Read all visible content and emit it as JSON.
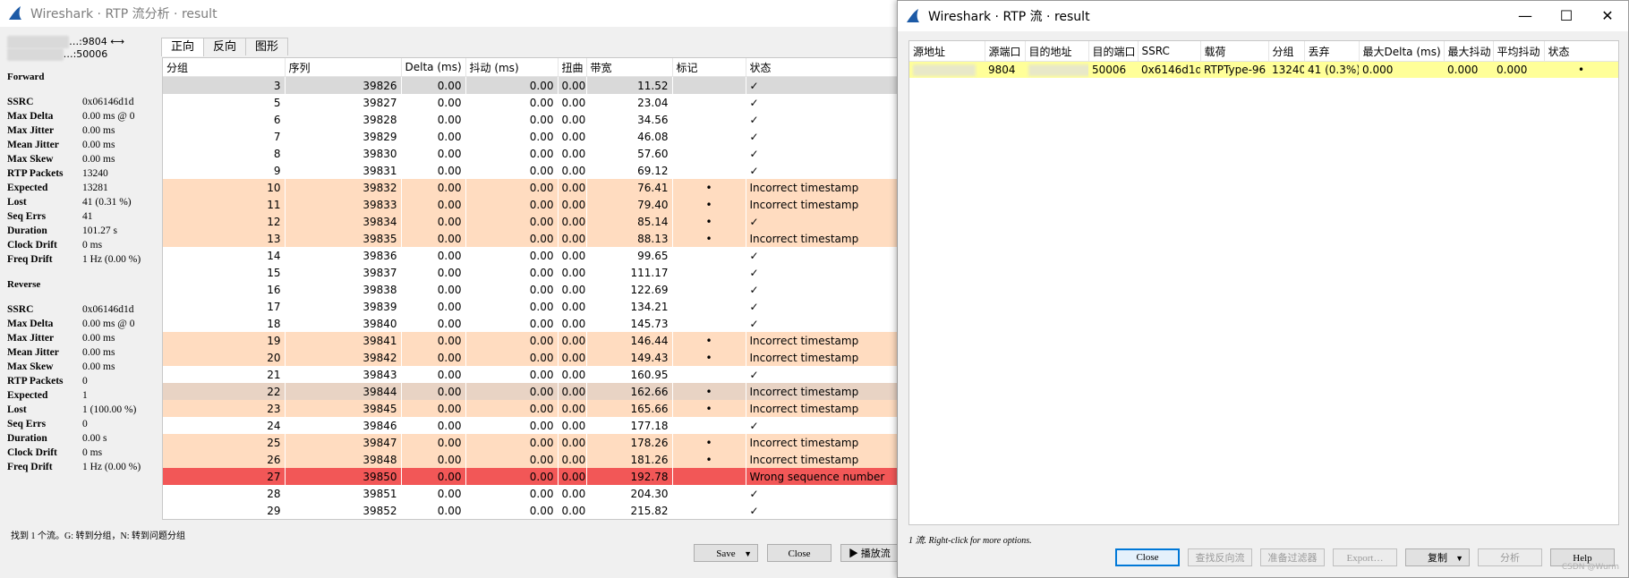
{
  "analysis_window": {
    "title": "Wireshark · RTP 流分析 · result",
    "stream_addr_line1": "…:9804 ⟷",
    "stream_addr_line2": "…:50006",
    "forward": {
      "heading": "Forward",
      "stats": [
        {
          "k": "SSRC",
          "v": "0x06146d1d"
        },
        {
          "k": "Max Delta",
          "v": "0.00 ms @ 0"
        },
        {
          "k": "Max Jitter",
          "v": "0.00 ms"
        },
        {
          "k": "Mean Jitter",
          "v": "0.00 ms"
        },
        {
          "k": "Max Skew",
          "v": "0.00 ms"
        },
        {
          "k": "RTP Packets",
          "v": "13240"
        },
        {
          "k": "Expected",
          "v": "13281"
        },
        {
          "k": "Lost",
          "v": "41 (0.31 %)"
        },
        {
          "k": "Seq Errs",
          "v": "41"
        },
        {
          "k": "Duration",
          "v": "101.27 s"
        },
        {
          "k": "Clock Drift",
          "v": "0 ms"
        },
        {
          "k": "Freq Drift",
          "v": "1 Hz (0.00 %)"
        }
      ]
    },
    "reverse": {
      "heading": "Reverse",
      "stats": [
        {
          "k": "SSRC",
          "v": "0x06146d1d"
        },
        {
          "k": "Max Delta",
          "v": "0.00 ms @ 0"
        },
        {
          "k": "Max Jitter",
          "v": "0.00 ms"
        },
        {
          "k": "Mean Jitter",
          "v": "0.00 ms"
        },
        {
          "k": "Max Skew",
          "v": "0.00 ms"
        },
        {
          "k": "RTP Packets",
          "v": "0"
        },
        {
          "k": "Expected",
          "v": "1"
        },
        {
          "k": "Lost",
          "v": "1 (100.00 %)"
        },
        {
          "k": "Seq Errs",
          "v": "0"
        },
        {
          "k": "Duration",
          "v": "0.00 s"
        },
        {
          "k": "Clock Drift",
          "v": "0 ms"
        },
        {
          "k": "Freq Drift",
          "v": "1 Hz (0.00 %)"
        }
      ]
    },
    "tabs": [
      "正向",
      "反向",
      "图形"
    ],
    "columns": [
      "分组",
      "序列",
      "Delta (ms)",
      "抖动 (ms)",
      "扭曲",
      "带宽",
      "标记",
      "状态"
    ],
    "rows": [
      {
        "pkt": "3",
        "seq": "39826",
        "delta": "0.00",
        "jitter": "0.00",
        "skew": "0.00",
        "bw": "11.52",
        "mark": "",
        "status": "✓",
        "kind": "sel"
      },
      {
        "pkt": "5",
        "seq": "39827",
        "delta": "0.00",
        "jitter": "0.00",
        "skew": "0.00",
        "bw": "23.04",
        "mark": "",
        "status": "✓",
        "kind": ""
      },
      {
        "pkt": "6",
        "seq": "39828",
        "delta": "0.00",
        "jitter": "0.00",
        "skew": "0.00",
        "bw": "34.56",
        "mark": "",
        "status": "✓",
        "kind": ""
      },
      {
        "pkt": "7",
        "seq": "39829",
        "delta": "0.00",
        "jitter": "0.00",
        "skew": "0.00",
        "bw": "46.08",
        "mark": "",
        "status": "✓",
        "kind": ""
      },
      {
        "pkt": "8",
        "seq": "39830",
        "delta": "0.00",
        "jitter": "0.00",
        "skew": "0.00",
        "bw": "57.60",
        "mark": "",
        "status": "✓",
        "kind": ""
      },
      {
        "pkt": "9",
        "seq": "39831",
        "delta": "0.00",
        "jitter": "0.00",
        "skew": "0.00",
        "bw": "69.12",
        "mark": "",
        "status": "✓",
        "kind": ""
      },
      {
        "pkt": "10",
        "seq": "39832",
        "delta": "0.00",
        "jitter": "0.00",
        "skew": "0.00",
        "bw": "76.41",
        "mark": "•",
        "status": "Incorrect timestamp",
        "kind": "warn"
      },
      {
        "pkt": "11",
        "seq": "39833",
        "delta": "0.00",
        "jitter": "0.00",
        "skew": "0.00",
        "bw": "79.40",
        "mark": "•",
        "status": "Incorrect timestamp",
        "kind": "warn"
      },
      {
        "pkt": "12",
        "seq": "39834",
        "delta": "0.00",
        "jitter": "0.00",
        "skew": "0.00",
        "bw": "85.14",
        "mark": "•",
        "status": "✓",
        "kind": "warn"
      },
      {
        "pkt": "13",
        "seq": "39835",
        "delta": "0.00",
        "jitter": "0.00",
        "skew": "0.00",
        "bw": "88.13",
        "mark": "•",
        "status": "Incorrect timestamp",
        "kind": "warn"
      },
      {
        "pkt": "14",
        "seq": "39836",
        "delta": "0.00",
        "jitter": "0.00",
        "skew": "0.00",
        "bw": "99.65",
        "mark": "",
        "status": "✓",
        "kind": ""
      },
      {
        "pkt": "15",
        "seq": "39837",
        "delta": "0.00",
        "jitter": "0.00",
        "skew": "0.00",
        "bw": "111.17",
        "mark": "",
        "status": "✓",
        "kind": ""
      },
      {
        "pkt": "16",
        "seq": "39838",
        "delta": "0.00",
        "jitter": "0.00",
        "skew": "0.00",
        "bw": "122.69",
        "mark": "",
        "status": "✓",
        "kind": ""
      },
      {
        "pkt": "17",
        "seq": "39839",
        "delta": "0.00",
        "jitter": "0.00",
        "skew": "0.00",
        "bw": "134.21",
        "mark": "",
        "status": "✓",
        "kind": ""
      },
      {
        "pkt": "18",
        "seq": "39840",
        "delta": "0.00",
        "jitter": "0.00",
        "skew": "0.00",
        "bw": "145.73",
        "mark": "",
        "status": "✓",
        "kind": ""
      },
      {
        "pkt": "19",
        "seq": "39841",
        "delta": "0.00",
        "jitter": "0.00",
        "skew": "0.00",
        "bw": "146.44",
        "mark": "•",
        "status": "Incorrect timestamp",
        "kind": "warn"
      },
      {
        "pkt": "20",
        "seq": "39842",
        "delta": "0.00",
        "jitter": "0.00",
        "skew": "0.00",
        "bw": "149.43",
        "mark": "•",
        "status": "Incorrect timestamp",
        "kind": "warn"
      },
      {
        "pkt": "21",
        "seq": "39843",
        "delta": "0.00",
        "jitter": "0.00",
        "skew": "0.00",
        "bw": "160.95",
        "mark": "",
        "status": "✓",
        "kind": ""
      },
      {
        "pkt": "22",
        "seq": "39844",
        "delta": "0.00",
        "jitter": "0.00",
        "skew": "0.00",
        "bw": "162.66",
        "mark": "•",
        "status": "Incorrect timestamp",
        "kind": "warn-dark"
      },
      {
        "pkt": "23",
        "seq": "39845",
        "delta": "0.00",
        "jitter": "0.00",
        "skew": "0.00",
        "bw": "165.66",
        "mark": "•",
        "status": "Incorrect timestamp",
        "kind": "warn"
      },
      {
        "pkt": "24",
        "seq": "39846",
        "delta": "0.00",
        "jitter": "0.00",
        "skew": "0.00",
        "bw": "177.18",
        "mark": "",
        "status": "✓",
        "kind": ""
      },
      {
        "pkt": "25",
        "seq": "39847",
        "delta": "0.00",
        "jitter": "0.00",
        "skew": "0.00",
        "bw": "178.26",
        "mark": "•",
        "status": "Incorrect timestamp",
        "kind": "warn"
      },
      {
        "pkt": "26",
        "seq": "39848",
        "delta": "0.00",
        "jitter": "0.00",
        "skew": "0.00",
        "bw": "181.26",
        "mark": "•",
        "status": "Incorrect timestamp",
        "kind": "warn"
      },
      {
        "pkt": "27",
        "seq": "39850",
        "delta": "0.00",
        "jitter": "0.00",
        "skew": "0.00",
        "bw": "192.78",
        "mark": "",
        "status": "Wrong sequence number",
        "kind": "err"
      },
      {
        "pkt": "28",
        "seq": "39851",
        "delta": "0.00",
        "jitter": "0.00",
        "skew": "0.00",
        "bw": "204.30",
        "mark": "",
        "status": "✓",
        "kind": ""
      },
      {
        "pkt": "29",
        "seq": "39852",
        "delta": "0.00",
        "jitter": "0.00",
        "skew": "0.00",
        "bw": "215.82",
        "mark": "",
        "status": "✓",
        "kind": ""
      }
    ],
    "footer_hint": "找到 1 个流。G: 转到分组，N: 转到问题分组",
    "buttons": {
      "save": "Save",
      "close": "Close",
      "play": "播放流"
    }
  },
  "streams_window": {
    "title": "Wireshark · RTP 流 · result",
    "columns": [
      "源地址",
      "源端口",
      "目的地址",
      "目的端口",
      "SSRC",
      "载荷",
      "分组",
      "丢弃",
      "最大Delta (ms)",
      "最大抖动",
      "平均抖动",
      "状态"
    ],
    "row": {
      "src_port": "9804",
      "dst_port": "50006",
      "ssrc": "0x6146d1d",
      "payload": "RTPType-96",
      "packets": "13240",
      "lost": "41 (0.3%)",
      "max_delta": "0.000",
      "max_jitter": "0.000",
      "mean_jitter": "0.000",
      "status": "•"
    },
    "footer_hint": "1 流. Right-click for more options.",
    "buttons": {
      "close": "Close",
      "find_reverse": "查找反向流",
      "prepare_filter": "准备过滤器",
      "export": "Export…",
      "copy": "复制",
      "analyze": "分析",
      "help": "Help"
    },
    "watermark": "CSDN @Wurm"
  },
  "colors": {
    "selected_row": "#d9d9d9",
    "warning_row": "#ffdcc0",
    "error_row": "#f25757",
    "stream_row": "#ffff99",
    "shark_blue": "#1c5aa6"
  }
}
